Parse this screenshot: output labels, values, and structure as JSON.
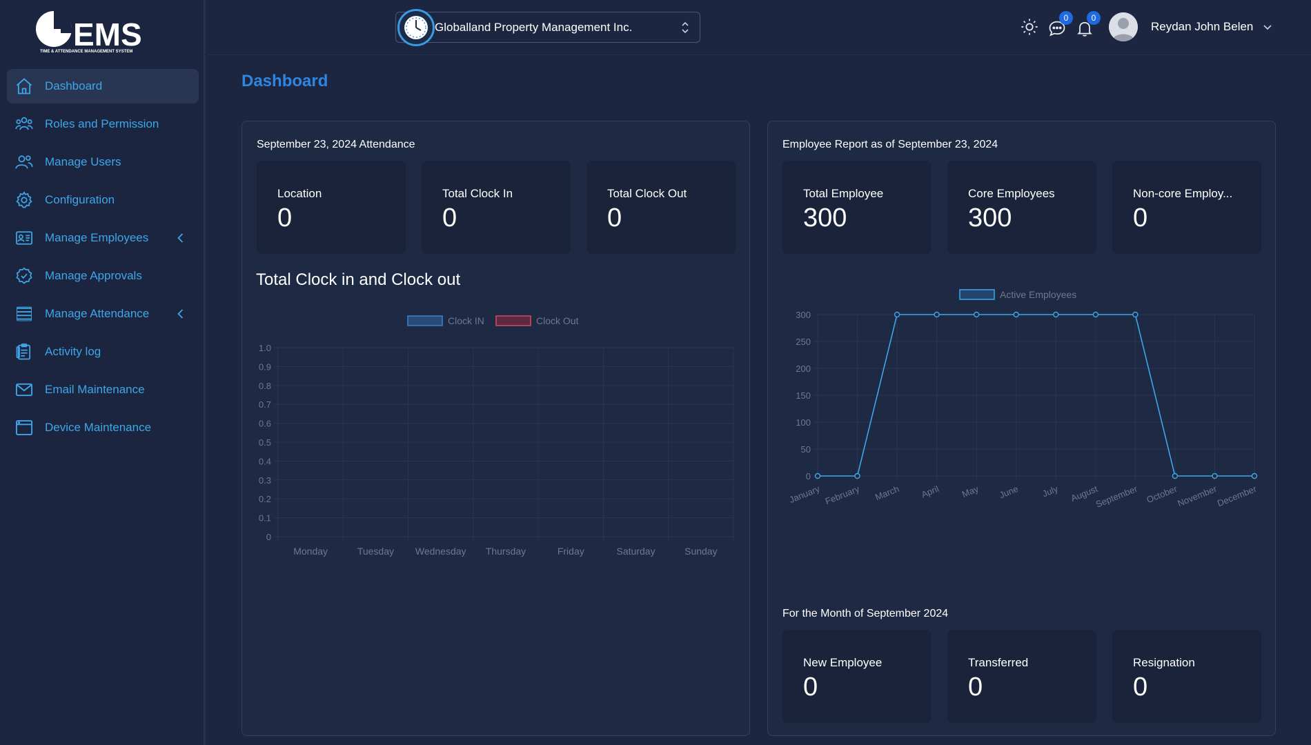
{
  "brand": {
    "logo_main": "EMS",
    "logo_tagline": "TIME & ATTENDANCE MANAGEMENT SYSTEM"
  },
  "sidebar": {
    "items": [
      {
        "label": "Dashboard",
        "icon": "home-icon",
        "active": true
      },
      {
        "label": "Roles and Permission",
        "icon": "users-group-icon"
      },
      {
        "label": "Manage Users",
        "icon": "users-icon"
      },
      {
        "label": "Configuration",
        "icon": "gear-icon"
      },
      {
        "label": "Manage Employees",
        "icon": "id-card-icon",
        "expandable": true
      },
      {
        "label": "Manage Approvals",
        "icon": "check-badge-icon"
      },
      {
        "label": "Manage Attendance",
        "icon": "list-icon",
        "expandable": true
      },
      {
        "label": "Activity log",
        "icon": "clipboard-icon"
      },
      {
        "label": "Email Maintenance",
        "icon": "mail-icon"
      },
      {
        "label": "Device Maintenance",
        "icon": "device-icon"
      }
    ]
  },
  "header": {
    "company": "Globalland Property Management Inc.",
    "messages_count": "0",
    "notifications_count": "0",
    "user_name": "Reydan John Belen"
  },
  "page": {
    "title": "Dashboard"
  },
  "attendance": {
    "heading": "September 23, 2024 Attendance",
    "stats": [
      {
        "label": "Location",
        "value": "0"
      },
      {
        "label": "Total Clock In",
        "value": "0"
      },
      {
        "label": "Total Clock Out",
        "value": "0"
      }
    ],
    "chart_title": "Total Clock in and Clock out"
  },
  "report": {
    "heading": "Employee Report as of September 23, 2024",
    "stats": [
      {
        "label": "Total Employee",
        "value": "300"
      },
      {
        "label": "Core Employees",
        "value": "300"
      },
      {
        "label": "Non-core Employ...",
        "value": "0"
      }
    ]
  },
  "month": {
    "heading": "For the Month of September 2024",
    "stats": [
      {
        "label": "New Employee",
        "value": "0"
      },
      {
        "label": "Transferred",
        "value": "0"
      },
      {
        "label": "Resignation",
        "value": "0"
      }
    ]
  },
  "colors": {
    "accent": "#3fa6e8",
    "title": "#2f86e0",
    "clock_in": "#3d7fd0",
    "clock_out": "#d04a6a",
    "badge": "#1f6ae0"
  },
  "chart_data": [
    {
      "type": "bar",
      "categories": [
        "Monday",
        "Tuesday",
        "Wednesday",
        "Thursday",
        "Friday",
        "Saturday",
        "Sunday"
      ],
      "series": [
        {
          "name": "Clock IN",
          "values": [
            0,
            0,
            0,
            0,
            0,
            0,
            0
          ]
        },
        {
          "name": "Clock Out",
          "values": [
            0,
            0,
            0,
            0,
            0,
            0,
            0
          ]
        }
      ],
      "yticks": [
        "1.0",
        "0.9",
        "0.8",
        "0.7",
        "0.6",
        "0.5",
        "0.4",
        "0.3",
        "0.2",
        "0.1",
        "0"
      ],
      "ylim": [
        0,
        1
      ],
      "legend": "top",
      "grid": true
    },
    {
      "type": "line",
      "categories": [
        "January",
        "February",
        "March",
        "April",
        "May",
        "June",
        "July",
        "August",
        "September",
        "October",
        "November",
        "December"
      ],
      "series": [
        {
          "name": "Active Employees",
          "values": [
            0,
            0,
            300,
            300,
            300,
            300,
            300,
            300,
            300,
            0,
            0,
            0
          ]
        }
      ],
      "yticks": [
        "300",
        "250",
        "200",
        "150",
        "100",
        "50",
        "0"
      ],
      "ylim": [
        0,
        300
      ],
      "legend": "top",
      "grid": true
    }
  ]
}
